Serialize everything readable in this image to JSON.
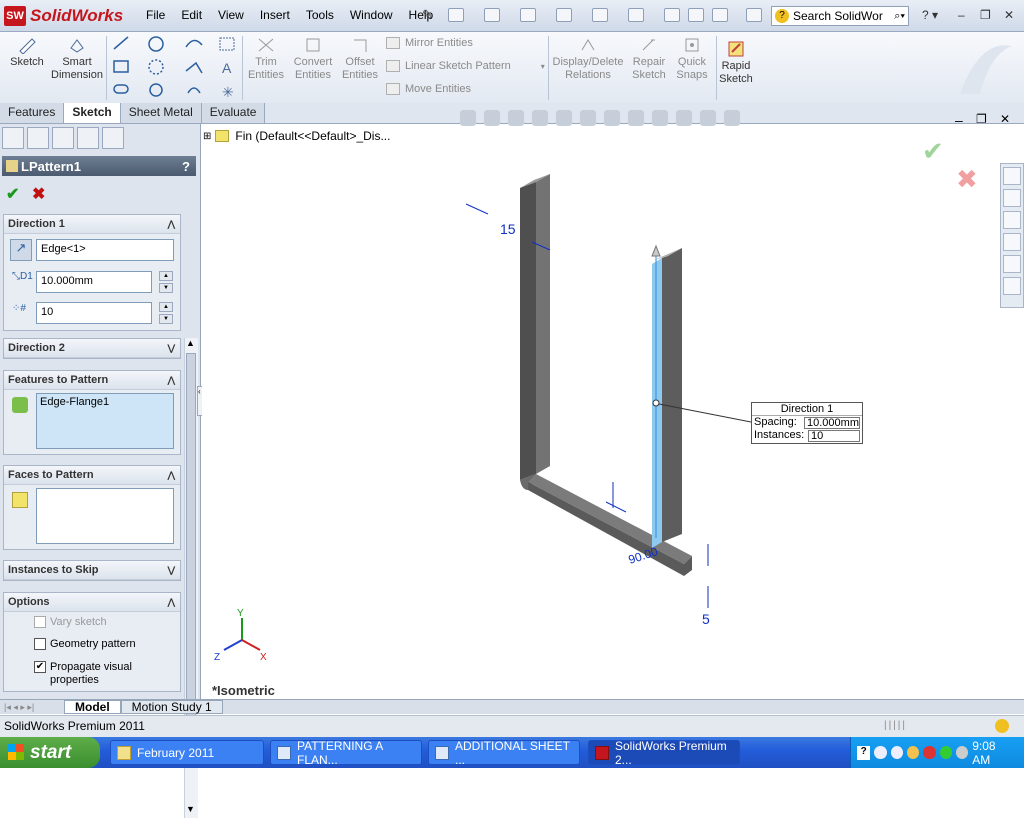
{
  "app": {
    "logo_text": "SolidWorks",
    "menus": [
      "File",
      "Edit",
      "View",
      "Insert",
      "Tools",
      "Window",
      "Help"
    ],
    "search_placeholder": "Search SolidWor"
  },
  "command_manager": {
    "sketch": "Sketch",
    "smart_dimension": "Smart\nDimension",
    "trim": "Trim\nEntities",
    "convert": "Convert\nEntities",
    "offset": "Offset\nEntities",
    "mirror": "Mirror Entities",
    "linear_pattern": "Linear Sketch Pattern",
    "move": "Move Entities",
    "display_delete": "Display/Delete\nRelations",
    "repair": "Repair\nSketch",
    "quick_snaps": "Quick\nSnaps",
    "rapid_sketch": "Rapid\nSketch"
  },
  "tabs": [
    "Features",
    "Sketch",
    "Sheet Metal",
    "Evaluate"
  ],
  "property_manager": {
    "title": "LPattern1",
    "help": "?",
    "direction1": {
      "header": "Direction 1",
      "edge": "Edge<1>",
      "spacing": "10.000mm",
      "instances": "10"
    },
    "direction2": {
      "header": "Direction 2"
    },
    "features_to_pattern": {
      "header": "Features to Pattern",
      "item": "Edge-Flange1"
    },
    "faces_to_pattern": {
      "header": "Faces to Pattern"
    },
    "instances_to_skip": {
      "header": "Instances to Skip"
    },
    "options": {
      "header": "Options",
      "vary_sketch": "Vary sketch",
      "geometry_pattern": "Geometry pattern",
      "propagate": "Propagate visual\nproperties"
    }
  },
  "graphics": {
    "tree_item": "Fin  (Default<<Default>_Dis...",
    "dimension_15": "15",
    "dimension_5": "5",
    "dimension_90": "90.00",
    "callout": {
      "title": "Direction 1",
      "spacing_label": "Spacing:",
      "spacing_value": "10.000mm",
      "instances_label": "Instances:",
      "instances_value": "10"
    },
    "view_label": "*Isometric",
    "axes": {
      "x": "X",
      "y": "Y",
      "z": "Z"
    }
  },
  "bottom_tabs": [
    "Model",
    "Motion Study 1"
  ],
  "status": "SolidWorks Premium 2011",
  "taskbar": {
    "start": "start",
    "tasks": [
      "February 2011",
      "PATTERNING A FLAN...",
      "ADDITIONAL SHEET ...",
      "SolidWorks Premium 2..."
    ],
    "clock": "9:08 AM"
  }
}
